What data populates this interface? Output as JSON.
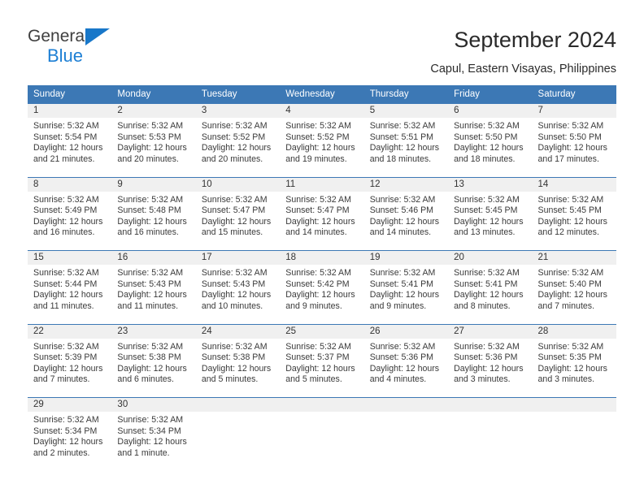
{
  "logo": {
    "word1": "General",
    "word2": "Blue",
    "triangle_color": "#1877c9",
    "word2_color": "#1d7fd4"
  },
  "header": {
    "title": "September 2024",
    "location": "Capul, Eastern Visayas, Philippines"
  },
  "theme": {
    "header_blue": "#3c78b5",
    "daynum_band": "#f0f0f0",
    "text": "#3a3a3a"
  },
  "calendar": {
    "weekday_headers": [
      "Sunday",
      "Monday",
      "Tuesday",
      "Wednesday",
      "Thursday",
      "Friday",
      "Saturday"
    ],
    "weeks": [
      [
        {
          "day": "1",
          "sunrise": "Sunrise: 5:32 AM",
          "sunset": "Sunset: 5:54 PM",
          "daylight1": "Daylight: 12 hours",
          "daylight2": "and 21 minutes."
        },
        {
          "day": "2",
          "sunrise": "Sunrise: 5:32 AM",
          "sunset": "Sunset: 5:53 PM",
          "daylight1": "Daylight: 12 hours",
          "daylight2": "and 20 minutes."
        },
        {
          "day": "3",
          "sunrise": "Sunrise: 5:32 AM",
          "sunset": "Sunset: 5:52 PM",
          "daylight1": "Daylight: 12 hours",
          "daylight2": "and 20 minutes."
        },
        {
          "day": "4",
          "sunrise": "Sunrise: 5:32 AM",
          "sunset": "Sunset: 5:52 PM",
          "daylight1": "Daylight: 12 hours",
          "daylight2": "and 19 minutes."
        },
        {
          "day": "5",
          "sunrise": "Sunrise: 5:32 AM",
          "sunset": "Sunset: 5:51 PM",
          "daylight1": "Daylight: 12 hours",
          "daylight2": "and 18 minutes."
        },
        {
          "day": "6",
          "sunrise": "Sunrise: 5:32 AM",
          "sunset": "Sunset: 5:50 PM",
          "daylight1": "Daylight: 12 hours",
          "daylight2": "and 18 minutes."
        },
        {
          "day": "7",
          "sunrise": "Sunrise: 5:32 AM",
          "sunset": "Sunset: 5:50 PM",
          "daylight1": "Daylight: 12 hours",
          "daylight2": "and 17 minutes."
        }
      ],
      [
        {
          "day": "8",
          "sunrise": "Sunrise: 5:32 AM",
          "sunset": "Sunset: 5:49 PM",
          "daylight1": "Daylight: 12 hours",
          "daylight2": "and 16 minutes."
        },
        {
          "day": "9",
          "sunrise": "Sunrise: 5:32 AM",
          "sunset": "Sunset: 5:48 PM",
          "daylight1": "Daylight: 12 hours",
          "daylight2": "and 16 minutes."
        },
        {
          "day": "10",
          "sunrise": "Sunrise: 5:32 AM",
          "sunset": "Sunset: 5:47 PM",
          "daylight1": "Daylight: 12 hours",
          "daylight2": "and 15 minutes."
        },
        {
          "day": "11",
          "sunrise": "Sunrise: 5:32 AM",
          "sunset": "Sunset: 5:47 PM",
          "daylight1": "Daylight: 12 hours",
          "daylight2": "and 14 minutes."
        },
        {
          "day": "12",
          "sunrise": "Sunrise: 5:32 AM",
          "sunset": "Sunset: 5:46 PM",
          "daylight1": "Daylight: 12 hours",
          "daylight2": "and 14 minutes."
        },
        {
          "day": "13",
          "sunrise": "Sunrise: 5:32 AM",
          "sunset": "Sunset: 5:45 PM",
          "daylight1": "Daylight: 12 hours",
          "daylight2": "and 13 minutes."
        },
        {
          "day": "14",
          "sunrise": "Sunrise: 5:32 AM",
          "sunset": "Sunset: 5:45 PM",
          "daylight1": "Daylight: 12 hours",
          "daylight2": "and 12 minutes."
        }
      ],
      [
        {
          "day": "15",
          "sunrise": "Sunrise: 5:32 AM",
          "sunset": "Sunset: 5:44 PM",
          "daylight1": "Daylight: 12 hours",
          "daylight2": "and 11 minutes."
        },
        {
          "day": "16",
          "sunrise": "Sunrise: 5:32 AM",
          "sunset": "Sunset: 5:43 PM",
          "daylight1": "Daylight: 12 hours",
          "daylight2": "and 11 minutes."
        },
        {
          "day": "17",
          "sunrise": "Sunrise: 5:32 AM",
          "sunset": "Sunset: 5:43 PM",
          "daylight1": "Daylight: 12 hours",
          "daylight2": "and 10 minutes."
        },
        {
          "day": "18",
          "sunrise": "Sunrise: 5:32 AM",
          "sunset": "Sunset: 5:42 PM",
          "daylight1": "Daylight: 12 hours",
          "daylight2": "and 9 minutes."
        },
        {
          "day": "19",
          "sunrise": "Sunrise: 5:32 AM",
          "sunset": "Sunset: 5:41 PM",
          "daylight1": "Daylight: 12 hours",
          "daylight2": "and 9 minutes."
        },
        {
          "day": "20",
          "sunrise": "Sunrise: 5:32 AM",
          "sunset": "Sunset: 5:41 PM",
          "daylight1": "Daylight: 12 hours",
          "daylight2": "and 8 minutes."
        },
        {
          "day": "21",
          "sunrise": "Sunrise: 5:32 AM",
          "sunset": "Sunset: 5:40 PM",
          "daylight1": "Daylight: 12 hours",
          "daylight2": "and 7 minutes."
        }
      ],
      [
        {
          "day": "22",
          "sunrise": "Sunrise: 5:32 AM",
          "sunset": "Sunset: 5:39 PM",
          "daylight1": "Daylight: 12 hours",
          "daylight2": "and 7 minutes."
        },
        {
          "day": "23",
          "sunrise": "Sunrise: 5:32 AM",
          "sunset": "Sunset: 5:38 PM",
          "daylight1": "Daylight: 12 hours",
          "daylight2": "and 6 minutes."
        },
        {
          "day": "24",
          "sunrise": "Sunrise: 5:32 AM",
          "sunset": "Sunset: 5:38 PM",
          "daylight1": "Daylight: 12 hours",
          "daylight2": "and 5 minutes."
        },
        {
          "day": "25",
          "sunrise": "Sunrise: 5:32 AM",
          "sunset": "Sunset: 5:37 PM",
          "daylight1": "Daylight: 12 hours",
          "daylight2": "and 5 minutes."
        },
        {
          "day": "26",
          "sunrise": "Sunrise: 5:32 AM",
          "sunset": "Sunset: 5:36 PM",
          "daylight1": "Daylight: 12 hours",
          "daylight2": "and 4 minutes."
        },
        {
          "day": "27",
          "sunrise": "Sunrise: 5:32 AM",
          "sunset": "Sunset: 5:36 PM",
          "daylight1": "Daylight: 12 hours",
          "daylight2": "and 3 minutes."
        },
        {
          "day": "28",
          "sunrise": "Sunrise: 5:32 AM",
          "sunset": "Sunset: 5:35 PM",
          "daylight1": "Daylight: 12 hours",
          "daylight2": "and 3 minutes."
        }
      ],
      [
        {
          "day": "29",
          "sunrise": "Sunrise: 5:32 AM",
          "sunset": "Sunset: 5:34 PM",
          "daylight1": "Daylight: 12 hours",
          "daylight2": "and 2 minutes."
        },
        {
          "day": "30",
          "sunrise": "Sunrise: 5:32 AM",
          "sunset": "Sunset: 5:34 PM",
          "daylight1": "Daylight: 12 hours",
          "daylight2": "and 1 minute."
        },
        {
          "day": "",
          "sunrise": "",
          "sunset": "",
          "daylight1": "",
          "daylight2": ""
        },
        {
          "day": "",
          "sunrise": "",
          "sunset": "",
          "daylight1": "",
          "daylight2": ""
        },
        {
          "day": "",
          "sunrise": "",
          "sunset": "",
          "daylight1": "",
          "daylight2": ""
        },
        {
          "day": "",
          "sunrise": "",
          "sunset": "",
          "daylight1": "",
          "daylight2": ""
        },
        {
          "day": "",
          "sunrise": "",
          "sunset": "",
          "daylight1": "",
          "daylight2": ""
        }
      ]
    ]
  }
}
